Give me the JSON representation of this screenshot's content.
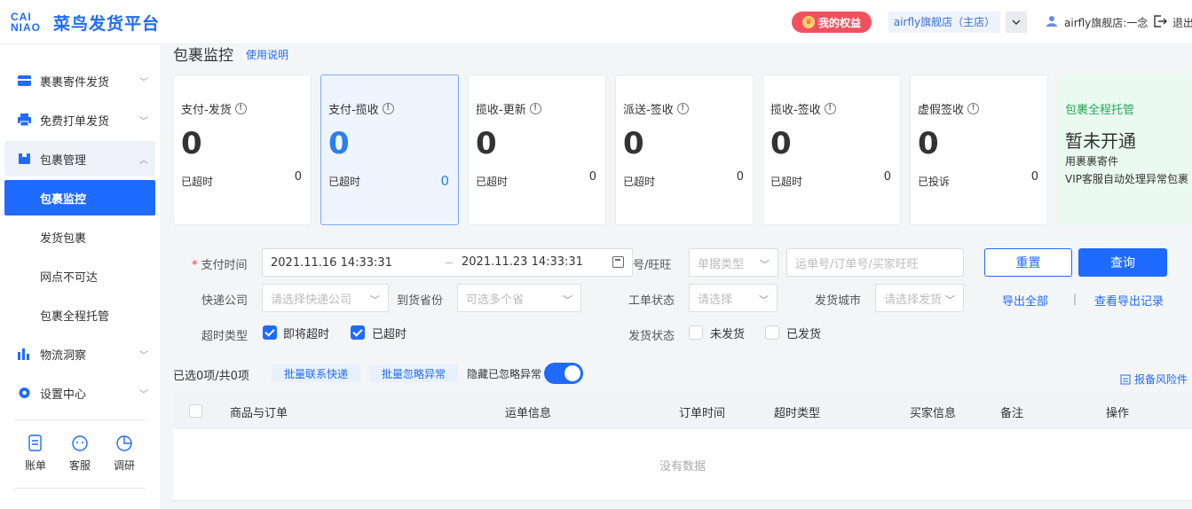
{
  "header": {
    "logo_mark_top": "CAI",
    "logo_mark_bottom": "NIAO",
    "logo_text": "菜鸟发货平台",
    "perk_button": "我的权益",
    "shop_chip": "airfly旗舰店（主店）",
    "user_name": "airfly旗舰店:一念",
    "logout": "退出"
  },
  "sidebar": {
    "items": [
      {
        "label": "裹裹寄件发货"
      },
      {
        "label": "免费打单发货"
      },
      {
        "label": "包裹管理"
      },
      {
        "label": "物流洞察"
      },
      {
        "label": "设置中心"
      }
    ],
    "sub_items": [
      {
        "label": "包裹监控"
      },
      {
        "label": "发货包裹"
      },
      {
        "label": "网点不可达"
      },
      {
        "label": "包裹全程托管"
      }
    ],
    "tools": [
      {
        "label": "账单"
      },
      {
        "label": "客服"
      },
      {
        "label": "调研"
      }
    ]
  },
  "main": {
    "title": "包裹监控",
    "help_link": "使用说明",
    "cards": [
      {
        "title": "支付-发货",
        "big": "0",
        "sub": "已超时",
        "sub_value": "0"
      },
      {
        "title": "支付-揽收",
        "big": "0",
        "sub": "已超时",
        "sub_value": "0"
      },
      {
        "title": "揽收-更新",
        "big": "0",
        "sub": "已超时",
        "sub_value": "0"
      },
      {
        "title": "派送-签收",
        "big": "0",
        "sub": "已超时",
        "sub_value": "0"
      },
      {
        "title": "揽收-签收",
        "big": "0",
        "sub": "已超时",
        "sub_value": "0"
      },
      {
        "title": "虚假签收",
        "big": "0",
        "sub": "已投诉",
        "sub_value": "0"
      }
    ],
    "promo": {
      "title": "包裹全程托管",
      "status": "暂未开通",
      "line1": "用裹裹寄件",
      "line2": "VIP客服自动处理异常包裹"
    },
    "filters": {
      "pay_time_label": "支付时间",
      "date_start": "2021.11.16 14:33:31",
      "date_end": "2021.11.23 14:33:31",
      "waybill_label": "号/旺旺",
      "doc_type_placeholder": "单据类型",
      "search_placeholder": "运单号/订单号/买家旺旺",
      "reset": "重置",
      "query": "查询",
      "courier_label": "快递公司",
      "courier_placeholder": "请选择快递公司",
      "province_label": "到货省份",
      "province_placeholder": "可选多个省",
      "ticket_label": "工单状态",
      "ticket_placeholder": "请选择",
      "city_label": "发货城市",
      "city_placeholder": "请选择发货",
      "export_all": "导出全部",
      "export_records": "查看导出记录",
      "timeout_label": "超时类型",
      "timeout_soon": "即将超时",
      "timeout_over": "已超时",
      "ship_label": "发货状态",
      "ship_not": "未发货",
      "ship_done": "已发货"
    },
    "toolbar": {
      "selected": "已选0项/共0项",
      "batch_contact": "批量联系快递",
      "batch_ignore": "批量忽略异常",
      "hide_ignored": "隐藏已忽略异常",
      "hide_ignored_on": true,
      "report": "报备风险件"
    },
    "table": {
      "columns": [
        "商品与订单",
        "运单信息",
        "订单时间",
        "超时类型",
        "买家信息",
        "备注",
        "操作"
      ],
      "empty": "没有数据"
    }
  },
  "colors": {
    "accent": "#1f6bff",
    "perk": "#f0515f",
    "promo_green": "#27a85a"
  }
}
